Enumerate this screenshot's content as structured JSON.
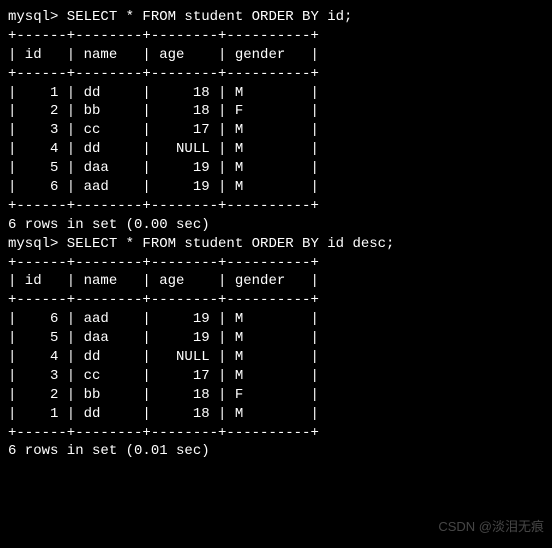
{
  "queries": [
    {
      "prompt": "mysql> ",
      "sql": "SELECT * FROM student ORDER BY id;"
    },
    {
      "prompt": "mysql> ",
      "sql": "SELECT * FROM student ORDER BY id desc;"
    }
  ],
  "table": {
    "columns": [
      "id",
      "name",
      "age",
      "gender"
    ],
    "widths": [
      4,
      6,
      6,
      8
    ],
    "align": [
      "right",
      "left",
      "right",
      "left"
    ]
  },
  "results": [
    {
      "rows": [
        {
          "id": "1",
          "name": "dd",
          "age": "18",
          "gender": "M"
        },
        {
          "id": "2",
          "name": "bb",
          "age": "18",
          "gender": "F"
        },
        {
          "id": "3",
          "name": "cc",
          "age": "17",
          "gender": "M"
        },
        {
          "id": "4",
          "name": "dd",
          "age": "NULL",
          "gender": "M"
        },
        {
          "id": "5",
          "name": "daa",
          "age": "19",
          "gender": "M"
        },
        {
          "id": "6",
          "name": "aad",
          "age": "19",
          "gender": "M"
        }
      ],
      "footer": "6 rows in set (0.00 sec)"
    },
    {
      "rows": [
        {
          "id": "6",
          "name": "aad",
          "age": "19",
          "gender": "M"
        },
        {
          "id": "5",
          "name": "daa",
          "age": "19",
          "gender": "M"
        },
        {
          "id": "4",
          "name": "dd",
          "age": "NULL",
          "gender": "M"
        },
        {
          "id": "3",
          "name": "cc",
          "age": "17",
          "gender": "M"
        },
        {
          "id": "2",
          "name": "bb",
          "age": "18",
          "gender": "F"
        },
        {
          "id": "1",
          "name": "dd",
          "age": "18",
          "gender": "M"
        }
      ],
      "footer": "6 rows in set (0.01 sec)"
    }
  ],
  "watermark": "CSDN @淡泪无痕"
}
